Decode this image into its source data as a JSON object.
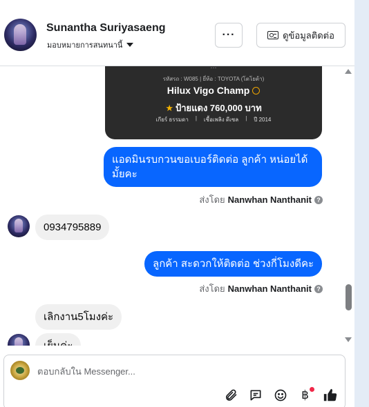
{
  "header": {
    "contact_name": "Sunantha Suriyasaeng",
    "assign_label": "มอบหมายการสนทนานี้",
    "more_label": "···",
    "contact_details_label": "ดูข้อมูลติดต่อ"
  },
  "car_card": {
    "top_text": "...",
    "meta": "รหัสรถ : W085 | ยี่ห้อ : TOYOTA (โตโยต้า)",
    "model": "Hilux Vigo Champ",
    "price": "ป้ายแดง 760,000 บาท",
    "specs": [
      "เกียร์ ธรรมดา",
      "เชื้อเพลิง ดีเซล",
      "ปี 2014"
    ]
  },
  "messages": [
    {
      "direction": "out",
      "text": "แอดมินรบกวนขอเบอร์ติดต่อ ลูกค้า หน่อยได้มั้ยคะ"
    },
    {
      "direction": "in",
      "text": "0934795889"
    },
    {
      "direction": "out",
      "text": "ลูกค้า สะดวกให้ติดต่อ ช่วงกี่โมงดีคะ"
    },
    {
      "direction": "in",
      "text": "เลิกงาน5โมงค่ะ"
    },
    {
      "direction": "in",
      "text": "เย็นค่ะ"
    }
  ],
  "sent_by": {
    "prefix": "ส่งโดย",
    "name": "Nanwhan Nanthanit",
    "info": "?"
  },
  "composer": {
    "placeholder": "ตอบกลับใน Messenger...",
    "tools": [
      "attachment-icon",
      "saved-reply-icon",
      "emoji-icon",
      "payment-icon",
      "like-icon"
    ],
    "payment_symbol": "฿"
  }
}
